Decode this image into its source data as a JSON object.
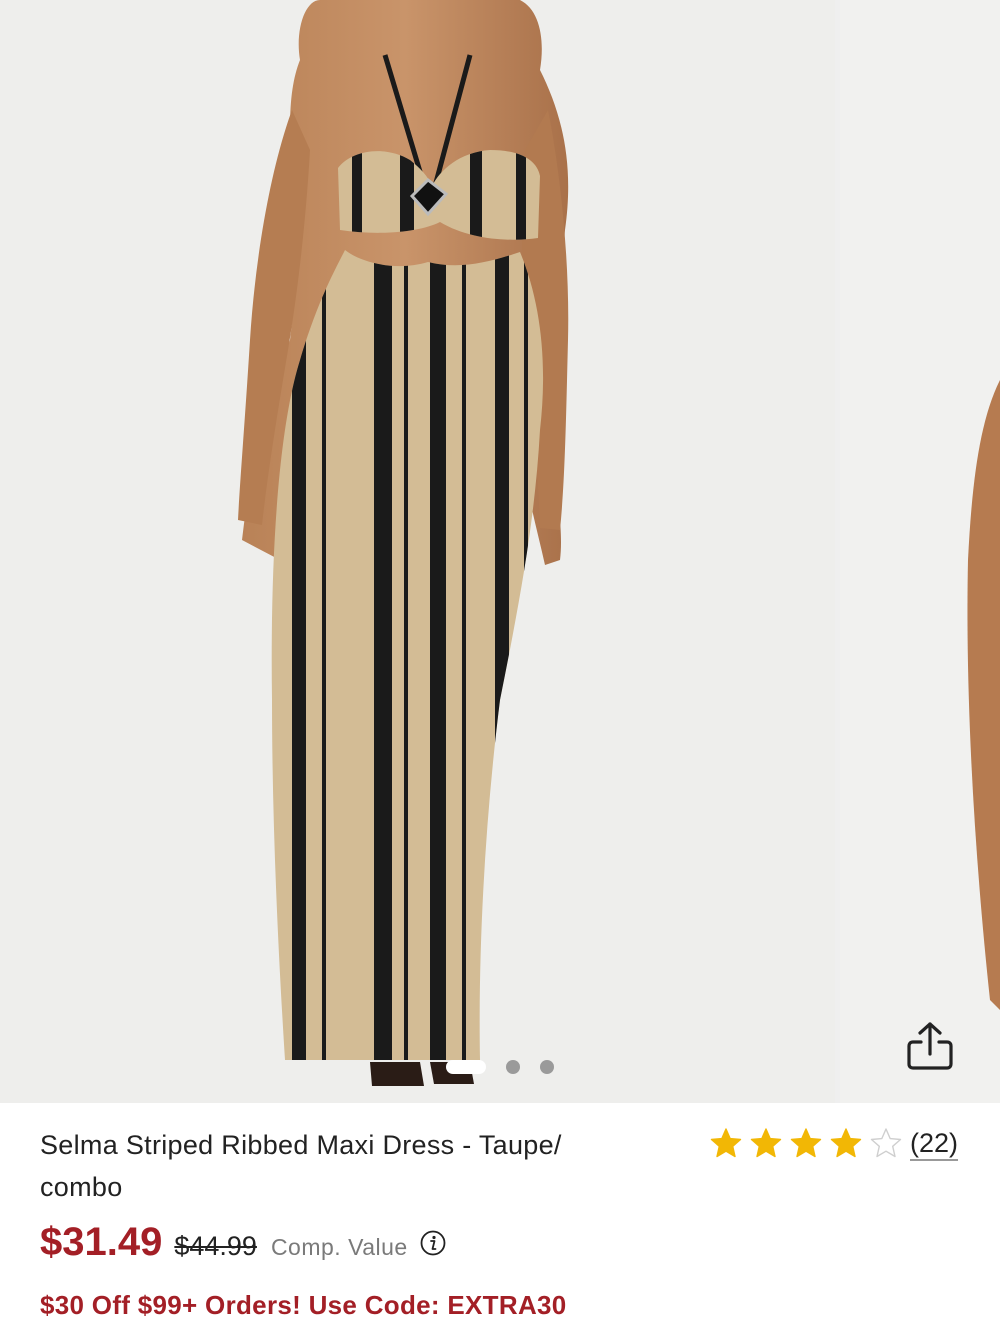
{
  "product": {
    "title": "Selma Striped Ribbed Maxi Dress - Taupe/ combo",
    "rating": 4.5,
    "review_count": "(22)",
    "price": "$31.49",
    "original_price": "$44.99",
    "comp_value_label": "Comp. Value",
    "promo": "$30 Off $99+ Orders! Use Code: EXTRA30"
  },
  "gallery": {
    "image_count": 3,
    "active_index": 0
  },
  "icons": {
    "share": "share-icon",
    "info": "info-icon",
    "star": "star-icon"
  },
  "colors": {
    "price_red": "#a31f26",
    "star_gold": "#f2b705",
    "dress_taupe": "#d3bc95",
    "stripe_black": "#1a1a1a"
  }
}
